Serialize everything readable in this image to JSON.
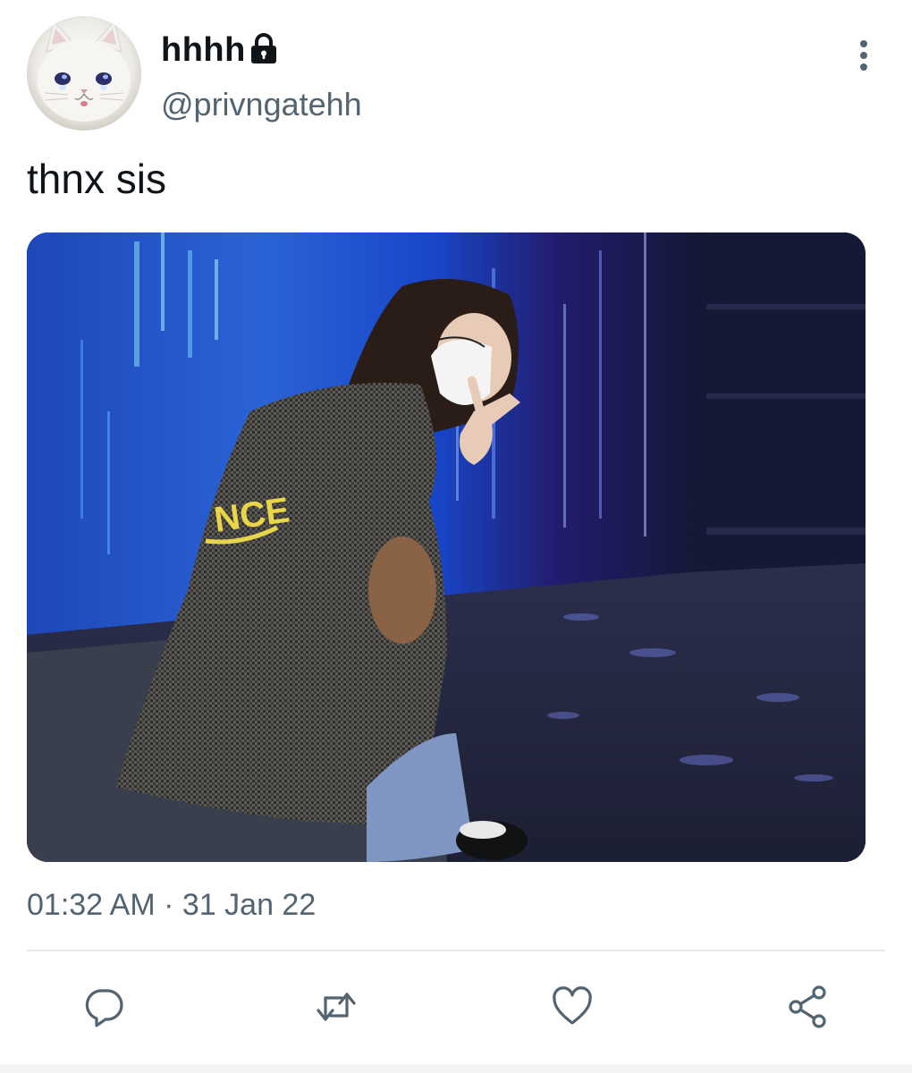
{
  "author": {
    "display_name": "hhhh",
    "handle": "@privngatehh",
    "avatar_icon": "crying-cat-avatar",
    "protected_icon": "lock-icon"
  },
  "tweet": {
    "text": "thnx sis",
    "time": "01:32 AM",
    "separator": "·",
    "date": "31 Jan 22"
  },
  "media": {
    "print_text": "NCE"
  },
  "actions": {
    "reply_icon": "reply-icon",
    "retweet_icon": "retweet-icon",
    "like_icon": "heart-icon",
    "share_icon": "share-icon",
    "more_icon": "more-vertical-icon"
  },
  "colors": {
    "text_primary": "#0f1419",
    "text_secondary": "#536471",
    "divider": "#e5e8eb"
  }
}
